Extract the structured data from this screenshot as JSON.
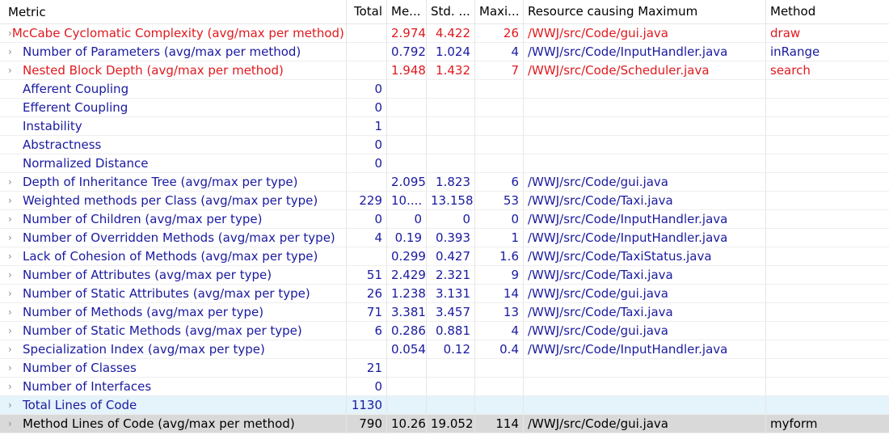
{
  "header": {
    "metric": "Metric",
    "total": "Total",
    "mean": "Me...",
    "std": "Std. ...",
    "max": "Maxi...",
    "resource": "Resource causing Maximum",
    "method": "Method"
  },
  "icons": {
    "expand": "chevron-right-icon"
  },
  "colors": {
    "violation": "#e0191e",
    "normal": "#1a1aa0",
    "selected_bg": "#d9d9d9",
    "hover_bg": "#e5f3fb"
  },
  "rows": [
    {
      "metric": "McCabe Cyclomatic Complexity (avg/max per method)",
      "total": "",
      "mean": "2.974",
      "std": "4.422",
      "max": "26",
      "resource": "/WWJ/src/Code/gui.java",
      "method": "draw",
      "expandable": true,
      "style": "red"
    },
    {
      "metric": "Number of Parameters (avg/max per method)",
      "total": "",
      "mean": "0.792",
      "std": "1.024",
      "max": "4",
      "resource": "/WWJ/src/Code/InputHandler.java",
      "method": "inRange",
      "expandable": true,
      "style": "blue"
    },
    {
      "metric": "Nested Block Depth (avg/max per method)",
      "total": "",
      "mean": "1.948",
      "std": "1.432",
      "max": "7",
      "resource": "/WWJ/src/Code/Scheduler.java",
      "method": "search",
      "expandable": true,
      "style": "red"
    },
    {
      "metric": "Afferent Coupling",
      "total": "0",
      "mean": "",
      "std": "",
      "max": "",
      "resource": "",
      "method": "",
      "expandable": false,
      "style": "blue"
    },
    {
      "metric": "Efferent Coupling",
      "total": "0",
      "mean": "",
      "std": "",
      "max": "",
      "resource": "",
      "method": "",
      "expandable": false,
      "style": "blue"
    },
    {
      "metric": "Instability",
      "total": "1",
      "mean": "",
      "std": "",
      "max": "",
      "resource": "",
      "method": "",
      "expandable": false,
      "style": "blue"
    },
    {
      "metric": "Abstractness",
      "total": "0",
      "mean": "",
      "std": "",
      "max": "",
      "resource": "",
      "method": "",
      "expandable": false,
      "style": "blue"
    },
    {
      "metric": "Normalized Distance",
      "total": "0",
      "mean": "",
      "std": "",
      "max": "",
      "resource": "",
      "method": "",
      "expandable": false,
      "style": "blue"
    },
    {
      "metric": "Depth of Inheritance Tree (avg/max per type)",
      "total": "",
      "mean": "2.095",
      "std": "1.823",
      "max": "6",
      "resource": "/WWJ/src/Code/gui.java",
      "method": "",
      "expandable": true,
      "style": "blue"
    },
    {
      "metric": "Weighted methods per Class (avg/max per type)",
      "total": "229",
      "mean": "10....",
      "std": "13.158",
      "max": "53",
      "resource": "/WWJ/src/Code/Taxi.java",
      "method": "",
      "expandable": true,
      "style": "blue"
    },
    {
      "metric": "Number of Children (avg/max per type)",
      "total": "0",
      "mean": "0",
      "std": "0",
      "max": "0",
      "resource": "/WWJ/src/Code/InputHandler.java",
      "method": "",
      "expandable": true,
      "style": "blue"
    },
    {
      "metric": "Number of Overridden Methods (avg/max per type)",
      "total": "4",
      "mean": "0.19",
      "std": "0.393",
      "max": "1",
      "resource": "/WWJ/src/Code/InputHandler.java",
      "method": "",
      "expandable": true,
      "style": "blue"
    },
    {
      "metric": "Lack of Cohesion of Methods (avg/max per type)",
      "total": "",
      "mean": "0.299",
      "std": "0.427",
      "max": "1.6",
      "resource": "/WWJ/src/Code/TaxiStatus.java",
      "method": "",
      "expandable": true,
      "style": "blue"
    },
    {
      "metric": "Number of Attributes (avg/max per type)",
      "total": "51",
      "mean": "2.429",
      "std": "2.321",
      "max": "9",
      "resource": "/WWJ/src/Code/Taxi.java",
      "method": "",
      "expandable": true,
      "style": "blue"
    },
    {
      "metric": "Number of Static Attributes (avg/max per type)",
      "total": "26",
      "mean": "1.238",
      "std": "3.131",
      "max": "14",
      "resource": "/WWJ/src/Code/gui.java",
      "method": "",
      "expandable": true,
      "style": "blue"
    },
    {
      "metric": "Number of Methods (avg/max per type)",
      "total": "71",
      "mean": "3.381",
      "std": "3.457",
      "max": "13",
      "resource": "/WWJ/src/Code/Taxi.java",
      "method": "",
      "expandable": true,
      "style": "blue"
    },
    {
      "metric": "Number of Static Methods (avg/max per type)",
      "total": "6",
      "mean": "0.286",
      "std": "0.881",
      "max": "4",
      "resource": "/WWJ/src/Code/gui.java",
      "method": "",
      "expandable": true,
      "style": "blue"
    },
    {
      "metric": "Specialization Index (avg/max per type)",
      "total": "",
      "mean": "0.054",
      "std": "0.12",
      "max": "0.4",
      "resource": "/WWJ/src/Code/InputHandler.java",
      "method": "",
      "expandable": true,
      "style": "blue"
    },
    {
      "metric": "Number of Classes",
      "total": "21",
      "mean": "",
      "std": "",
      "max": "",
      "resource": "",
      "method": "",
      "expandable": true,
      "style": "blue"
    },
    {
      "metric": "Number of Interfaces",
      "total": "0",
      "mean": "",
      "std": "",
      "max": "",
      "resource": "",
      "method": "",
      "expandable": true,
      "style": "blue"
    },
    {
      "metric": "Total Lines of Code",
      "total": "1130",
      "mean": "",
      "std": "",
      "max": "",
      "resource": "",
      "method": "",
      "expandable": true,
      "style": "blue",
      "row_state": "highlight"
    },
    {
      "metric": "Method Lines of Code (avg/max per method)",
      "total": "790",
      "mean": "10.26",
      "std": "19.052",
      "max": "114",
      "resource": "/WWJ/src/Code/gui.java",
      "method": "myform",
      "expandable": true,
      "style": "black",
      "row_state": "selected"
    }
  ]
}
